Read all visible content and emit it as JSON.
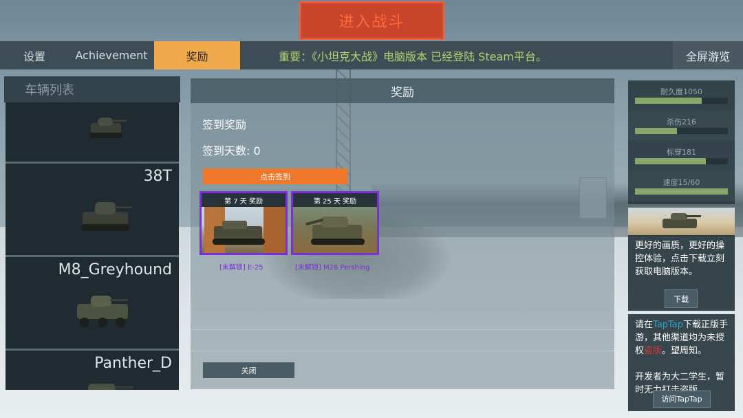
{
  "battle_button": "进入战斗",
  "nav": {
    "settings": "设置",
    "achievement": "Achievement",
    "rewards": "奖励",
    "notice": "重要：《小坦克大战》电脑版本 已经登陆 Steam平台。",
    "fullscreen": "全屏游览"
  },
  "vehicle_list": {
    "header": "车辆列表",
    "items": [
      {
        "name": ""
      },
      {
        "name": "38T"
      },
      {
        "name": "M8_Greyhound"
      },
      {
        "name": "Panther_D"
      }
    ]
  },
  "rewards_panel": {
    "title": "奖励",
    "signin_title": "签到奖励",
    "signin_days": "签到天数: 0",
    "signin_button": "点击签到",
    "cards": [
      {
        "title": "第 7 天 奖励",
        "caption": "[未解锁] E-25"
      },
      {
        "title": "第 25 天 奖励",
        "caption": "[未解锁] M26 Pershing"
      }
    ],
    "close_button": "关闭"
  },
  "stats": [
    {
      "label": "耐久度1050",
      "fill": 0.72
    },
    {
      "label": "杀伤216",
      "fill": 0.45
    },
    {
      "label": "标穿181",
      "fill": 0.76
    },
    {
      "label": "速度15/60",
      "fill": 1.0
    }
  ],
  "promo": {
    "text": "更好的画质，更好的操控体验，点击下载立刻获取电脑版本。",
    "download_button": "下载"
  },
  "notice_box": {
    "prefix": "请在",
    "taptap": "TapTap",
    "middle": "下载正版手游，其他渠道均为未授权",
    "pirate": "盗版",
    "suffix": "。望周知。",
    "developer_note": "开发者为大二学生，暂时无力打击盗版",
    "visit_button": "访问TapTap"
  },
  "colors": {
    "accent_orange": "#f0a94a",
    "signin_orange": "#f0782a",
    "battle_red": "#c8442b",
    "card_border_purple": "#7a2fd8",
    "notice_green": "#b5d36f",
    "stat_green": "#88a86a"
  }
}
